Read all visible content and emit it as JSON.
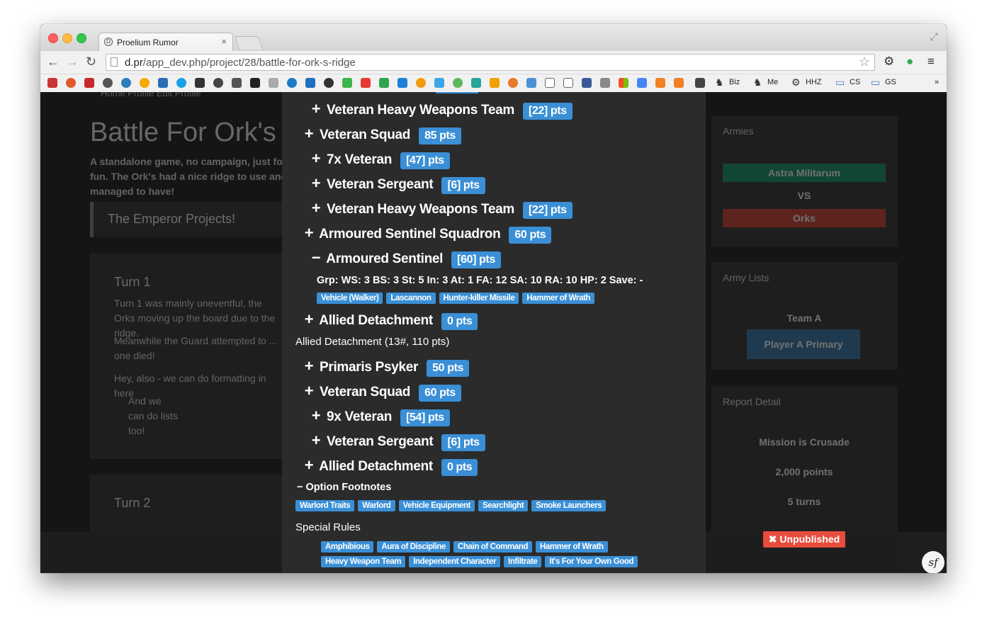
{
  "browser": {
    "tab_title": "Proelium Rumor",
    "url_host": "d.pr",
    "url_path": "/app_dev.php/project/28/battle-for-ork-s-ridge",
    "bookmarks": [
      {
        "label": "Biz"
      },
      {
        "label": "Me"
      },
      {
        "label": "HHZ"
      },
      {
        "label": "CS"
      },
      {
        "label": "GS"
      }
    ],
    "bookmarks_more": "»"
  },
  "background_page": {
    "nav": "Home      Profile      Edit Profile",
    "title": "Battle For Ork's Ridge",
    "description": "A standalone game, no campaign, just for fun. The Ork's had a nice ridge to use and managed to have!",
    "quote": "The Emperor Projects!",
    "turn1_heading": "Turn 1",
    "turn1_p1": "Turn 1 was mainly uneventful, the Orks moving up the board due to the ridge.",
    "turn1_p2": "Meanwhile the Guard attempted to ... one died!",
    "turn1_p3": "Hey, also - we can do formatting in here",
    "list_items": [
      "And we",
      "can do lists",
      "too!"
    ],
    "turn2_heading": "Turn 2",
    "armies_heading": "Armies",
    "army1": "Astra Militarum",
    "vs": "VS",
    "army2": "Orks",
    "army_lists_heading": "Army Lists",
    "team": "Team A",
    "player_button": "Player A Primary",
    "report_heading": "Report Detail",
    "report_rows": [
      "Mission is Crusade",
      "2,000 points",
      "5 turns"
    ],
    "colors": {
      "army1": "#0f8a5f",
      "army2": "#c0392b",
      "player_button": "#2d6f9e"
    }
  },
  "modal": {
    "units": [
      {
        "sym": "+",
        "name": "Veteran Heavy Weapons Team",
        "pts": "[22] pts"
      },
      {
        "sym": "+",
        "name": "Veteran Squad",
        "pts": "85 pts"
      },
      {
        "sym": "+",
        "name": "7x Veteran",
        "pts": "[47] pts"
      },
      {
        "sym": "+",
        "name": "Veteran Sergeant",
        "pts": "[6] pts"
      },
      {
        "sym": "+",
        "name": "Veteran Heavy Weapons Team",
        "pts": "[22] pts"
      },
      {
        "sym": "+",
        "name": "Armoured Sentinel Squadron",
        "pts": "60 pts"
      },
      {
        "sym": "−",
        "name": "Armoured Sentinel",
        "pts": "[60] pts"
      },
      {
        "sym": "+",
        "name": "Allied Detachment",
        "pts": "0 pts"
      },
      {
        "sym": "+",
        "name": "Primaris Psyker",
        "pts": "50 pts"
      },
      {
        "sym": "+",
        "name": "Veteran Squad",
        "pts": "60 pts"
      },
      {
        "sym": "+",
        "name": "9x Veteran",
        "pts": "[54] pts"
      },
      {
        "sym": "+",
        "name": "Veteran Sergeant",
        "pts": "[6] pts"
      },
      {
        "sym": "+",
        "name": "Allied Detachment",
        "pts": "0 pts"
      }
    ],
    "stats_line": "Grp: WS: 3 BS: 3 St: 5 In: 3 At: 1 FA: 12 SA: 10 RA: 10 HP: 2 Save: -",
    "sentinel_tags": [
      "Vehicle (Walker)",
      "Lascannon",
      "Hunter-killer Missile",
      "Hammer of Wrath"
    ],
    "allied_line": "Allied Detachment (13#, 110 pts)",
    "footnotes_heading": "− Option Footnotes",
    "footnote_tags": [
      "Warlord Traits",
      "Warlord",
      "Vehicle Equipment",
      "Searchlight",
      "Smoke Launchers"
    ],
    "special_rules_heading": "Special Rules",
    "special_rules_row1": [
      "Amphibious",
      "Aura of Discipline",
      "Chain of Command",
      "Hammer of Wrath"
    ],
    "special_rules_row2": [
      "Heavy Weapon Team",
      "Independent Character",
      "Infiltrate",
      "It's For Your Own Good"
    ]
  },
  "unpublished_label": "✖ Unpublished",
  "symfony_label": "sf"
}
